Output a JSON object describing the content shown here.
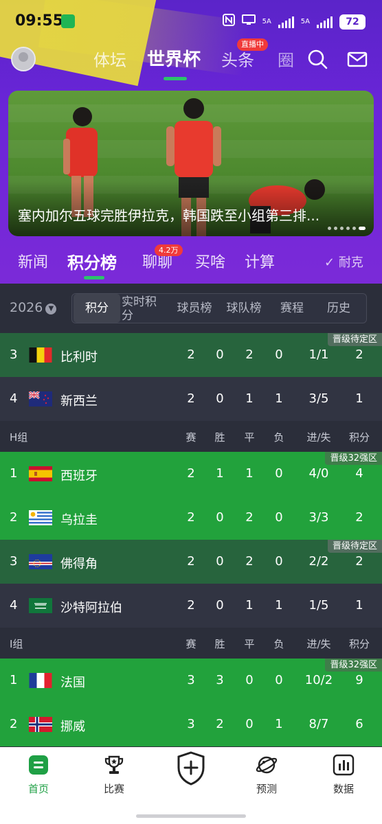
{
  "status": {
    "time": "09:55",
    "net1": "5A",
    "net2": "5A",
    "battery": "72"
  },
  "nav": {
    "tabs": [
      "体坛",
      "世界杯",
      "头条",
      "圈"
    ],
    "live_badge": "直播中"
  },
  "banner": {
    "caption": "塞内加尔五球完胜伊拉克，韩国跌至小组第三排..."
  },
  "sub_tabs": {
    "items": [
      "新闻",
      "积分榜",
      "聊聊",
      "买啥",
      "计算"
    ],
    "chat_badge": "4.2万",
    "sponsor": "耐克"
  },
  "filter": {
    "season": "2026",
    "segments": [
      "积分",
      "实时积分",
      "球员榜",
      "球队榜",
      "赛程",
      "历史"
    ]
  },
  "headers": [
    "赛",
    "胜",
    "平",
    "负",
    "进/失",
    "积分"
  ],
  "groups": [
    {
      "name": "",
      "rows": [
        {
          "rank": "3",
          "team": "比利时",
          "flag": "belgium",
          "p": "2",
          "w": "0",
          "d": "2",
          "l": "0",
          "gf_ga": "1/1",
          "pts": "2",
          "tag": "晋级待定区",
          "style": "dkgreen"
        },
        {
          "rank": "4",
          "team": "新西兰",
          "flag": "newzealand",
          "p": "2",
          "w": "0",
          "d": "1",
          "l": "1",
          "gf_ga": "3/5",
          "pts": "1",
          "tag": "",
          "style": "dark"
        }
      ]
    },
    {
      "name": "H组",
      "rows": [
        {
          "rank": "1",
          "team": "西班牙",
          "flag": "spain",
          "p": "2",
          "w": "1",
          "d": "1",
          "l": "0",
          "gf_ga": "4/0",
          "pts": "4",
          "tag": "晋级32强区",
          "style": "green"
        },
        {
          "rank": "2",
          "team": "乌拉圭",
          "flag": "uruguay",
          "p": "2",
          "w": "0",
          "d": "2",
          "l": "0",
          "gf_ga": "3/3",
          "pts": "2",
          "tag": "",
          "style": "green"
        },
        {
          "rank": "3",
          "team": "佛得角",
          "flag": "capeverde",
          "p": "2",
          "w": "0",
          "d": "2",
          "l": "0",
          "gf_ga": "2/2",
          "pts": "2",
          "tag": "晋级待定区",
          "style": "dkgreen"
        },
        {
          "rank": "4",
          "team": "沙特阿拉伯",
          "flag": "saudi",
          "p": "2",
          "w": "0",
          "d": "1",
          "l": "1",
          "gf_ga": "1/5",
          "pts": "1",
          "tag": "",
          "style": "dark"
        }
      ]
    },
    {
      "name": "I组",
      "rows": [
        {
          "rank": "1",
          "team": "法国",
          "flag": "france",
          "p": "3",
          "w": "3",
          "d": "0",
          "l": "0",
          "gf_ga": "10/2",
          "pts": "9",
          "tag": "晋级32强区",
          "style": "green"
        },
        {
          "rank": "2",
          "team": "挪威",
          "flag": "norway",
          "p": "3",
          "w": "2",
          "d": "0",
          "l": "1",
          "gf_ga": "8/7",
          "pts": "6",
          "tag": "",
          "style": "green"
        }
      ]
    }
  ],
  "bottom": {
    "items": [
      {
        "label": "首页",
        "icon": "home-icon"
      },
      {
        "label": "比赛",
        "icon": "trophy-icon"
      },
      {
        "label": "",
        "icon": "shield-plus-icon"
      },
      {
        "label": "预测",
        "icon": "planet-icon"
      },
      {
        "label": "数据",
        "icon": "bar-chart-icon"
      }
    ]
  },
  "colors": {
    "header_purple": "#6a25d8",
    "accent_green": "#2cc36b",
    "qualify_green": "#22a23c",
    "pending_green": "#27643d",
    "badge_red": "#f03a3a"
  }
}
